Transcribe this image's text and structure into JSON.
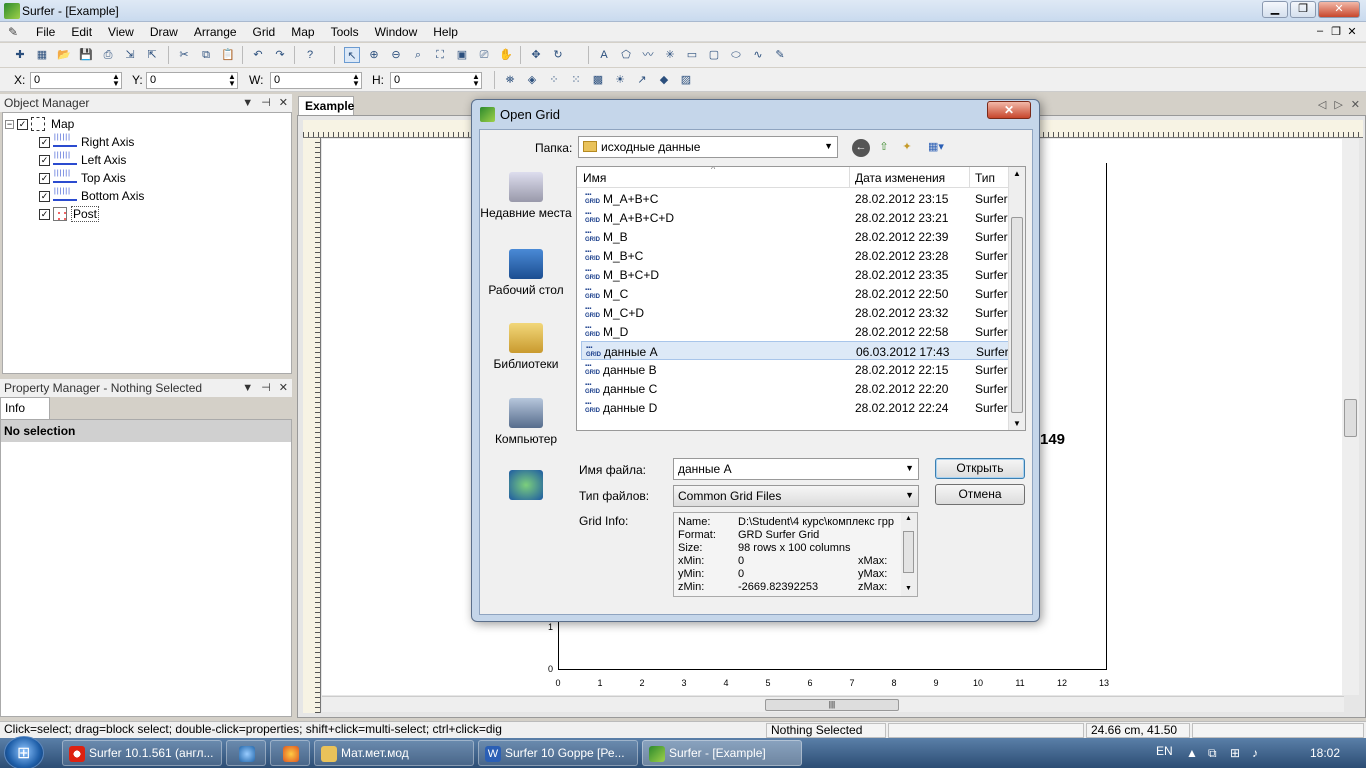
{
  "app": {
    "title": "Surfer - [Example]",
    "menu": [
      "File",
      "Edit",
      "View",
      "Draw",
      "Arrange",
      "Grid",
      "Map",
      "Tools",
      "Window",
      "Help"
    ]
  },
  "coords": {
    "x_label": "X:",
    "x_value": "0",
    "y_label": "Y:",
    "y_value": "0",
    "w_label": "W:",
    "w_value": "0",
    "h_label": "H:",
    "h_value": "0"
  },
  "object_manager": {
    "title": "Object Manager",
    "root": "Map",
    "items": [
      "Right Axis",
      "Left Axis",
      "Top Axis",
      "Bottom Axis",
      "Post"
    ]
  },
  "property_manager": {
    "title": "Property Manager - Nothing Selected",
    "tab": "Info",
    "status": "No selection"
  },
  "document": {
    "tab": "Example",
    "x_ticks": [
      "0",
      "1",
      "2",
      "3",
      "4",
      "5",
      "6",
      "7",
      "8",
      "9",
      "10",
      "11",
      "12",
      "13"
    ],
    "y_tick_1": "1",
    "y_tick_0": "0",
    "partial_label": "149"
  },
  "dialog": {
    "title": "Open Grid",
    "close": "✕",
    "folder_label": "Папка:",
    "folder_value": "исходные данные",
    "places": [
      "Недавние места",
      "Рабочий стол",
      "Библиотеки",
      "Компьютер",
      ""
    ],
    "columns": {
      "name": "Имя",
      "date": "Дата изменения",
      "type": "Тип"
    },
    "files": [
      {
        "name": "M_A+B+C",
        "date": "28.02.2012 23:15",
        "type": "Surfer"
      },
      {
        "name": "M_A+B+C+D",
        "date": "28.02.2012 23:21",
        "type": "Surfer"
      },
      {
        "name": "M_B",
        "date": "28.02.2012 22:39",
        "type": "Surfer"
      },
      {
        "name": "M_B+C",
        "date": "28.02.2012 23:28",
        "type": "Surfer"
      },
      {
        "name": "M_B+C+D",
        "date": "28.02.2012 23:35",
        "type": "Surfer"
      },
      {
        "name": "M_C",
        "date": "28.02.2012 22:50",
        "type": "Surfer"
      },
      {
        "name": "M_C+D",
        "date": "28.02.2012 23:32",
        "type": "Surfer"
      },
      {
        "name": "M_D",
        "date": "28.02.2012 22:58",
        "type": "Surfer"
      },
      {
        "name": "данные А",
        "date": "06.03.2012 17:43",
        "type": "Surfer"
      },
      {
        "name": "данные В",
        "date": "28.02.2012 22:15",
        "type": "Surfer"
      },
      {
        "name": "данные С",
        "date": "28.02.2012 22:20",
        "type": "Surfer"
      },
      {
        "name": "данные D",
        "date": "28.02.2012 22:24",
        "type": "Surfer"
      }
    ],
    "filename_label": "Имя файла:",
    "filename_value": "данные А",
    "filetype_label": "Тип файлов:",
    "filetype_value": "Common Grid Files",
    "open_button": "Открыть",
    "cancel_button": "Отмена",
    "info_label": "Grid Info:",
    "info": {
      "name_k": "Name:",
      "name_v": "D:\\Student\\4 курс\\комплекс грр",
      "format_k": "Format:",
      "format_v": "GRD Surfer Grid",
      "size_k": "Size:",
      "size_v": "98 rows x 100 columns",
      "xmin_k": "xMin:",
      "xmin_v": "0",
      "xmax_k": "xMax:",
      "ymin_k": "yMin:",
      "ymin_v": "0",
      "ymax_k": "yMax:",
      "zmin_k": "zMin:",
      "zmin_v": "-2669.82392253",
      "zmax_k": "zMax:"
    }
  },
  "statusbar": {
    "hint": "Click=select; drag=block select; double-click=properties; shift+click=multi-select; ctrl+click=dig",
    "selection": "Nothing Selected",
    "position": "24.66 cm, 41.50 cm"
  },
  "taskbar": {
    "tasks": [
      "Surfer 10.1.561 (англ...",
      "",
      "",
      "Мат.мет.мод",
      "Surfer 10 Goppe [Ре...",
      "Surfer - [Example]"
    ],
    "lang": "EN",
    "clock": "18:02"
  }
}
